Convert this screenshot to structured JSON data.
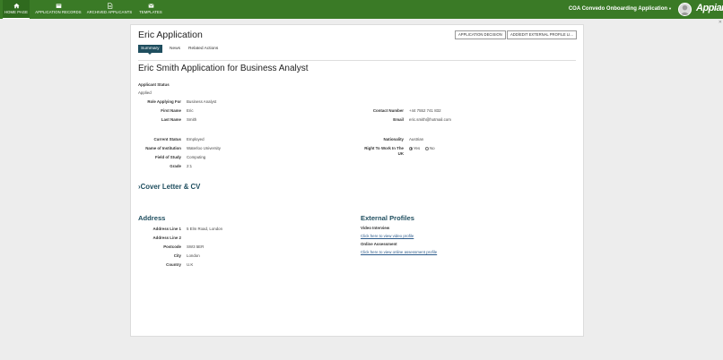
{
  "topnav": {
    "items": [
      {
        "label": "HOME PAGE",
        "icon": "home-icon"
      },
      {
        "label": "APPLICATION RECORDS",
        "icon": "folder-icon"
      },
      {
        "label": "ARCHIVED APPLICANTS",
        "icon": "document-icon"
      },
      {
        "label": "TEMPLATES",
        "icon": "mail-icon"
      }
    ],
    "app_title": "COA Convedo Onboarding Application",
    "brand": "Appian"
  },
  "page": {
    "title": "Eric Application",
    "buttons": {
      "decision": "APPLICATION DECISION",
      "external_profile": "ADD/EDIT EXTERNAL PROFILE LI..."
    },
    "tabs": [
      "Summary",
      "News",
      "Related Actions"
    ],
    "heading": "Eric Smith Application for Business Analyst"
  },
  "applicant": {
    "status_label": "Applicant Status",
    "status_value": "Applied",
    "role_label": "Role Applying For",
    "role_value": "Business Analyst",
    "first_name_label": "First Name",
    "first_name_value": "Eric",
    "last_name_label": "Last Name",
    "last_name_value": "Smith",
    "contact_label": "Contact Number",
    "contact_value": "+44 7552 741 832",
    "email_label": "Email",
    "email_value": "eric.smith@hotmail.com",
    "current_status_label": "Current Status",
    "current_status_value": "Employed",
    "institution_label": "Name of Institution",
    "institution_value": "Waterloo University",
    "field_label": "Field of Study",
    "field_value": "Computing",
    "grade_label": "Grade",
    "grade_value": "2:1",
    "nationality_label": "Nationality",
    "nationality_value": "Austrian",
    "right_to_work_label_1": "Right To Work In The",
    "right_to_work_label_2": "UK",
    "right_to_work_yes": "Yes",
    "right_to_work_no": "No",
    "right_to_work_selected": "Yes"
  },
  "cover_letter": {
    "toggle_label": "Cover Letter & CV"
  },
  "address": {
    "heading": "Address",
    "line1_label": "Address Line 1",
    "line1_value": "5 Elm Road, London",
    "line2_label": "Address Line 2",
    "postcode_label": "Postcode",
    "postcode_value": "SW3 5ER",
    "city_label": "City",
    "city_value": "London",
    "country_label": "Country",
    "country_value": "U.K"
  },
  "external_profiles": {
    "heading": "External Profiles",
    "video_label": "Video Interview",
    "video_link": "Click here to view video profile",
    "assessment_label": "Online Assessment",
    "assessment_link": "Click here to view online assessment profile"
  },
  "colors": {
    "topbar": "#3a7a26",
    "accent": "#1f4e5f",
    "link": "#2b5a8a"
  }
}
